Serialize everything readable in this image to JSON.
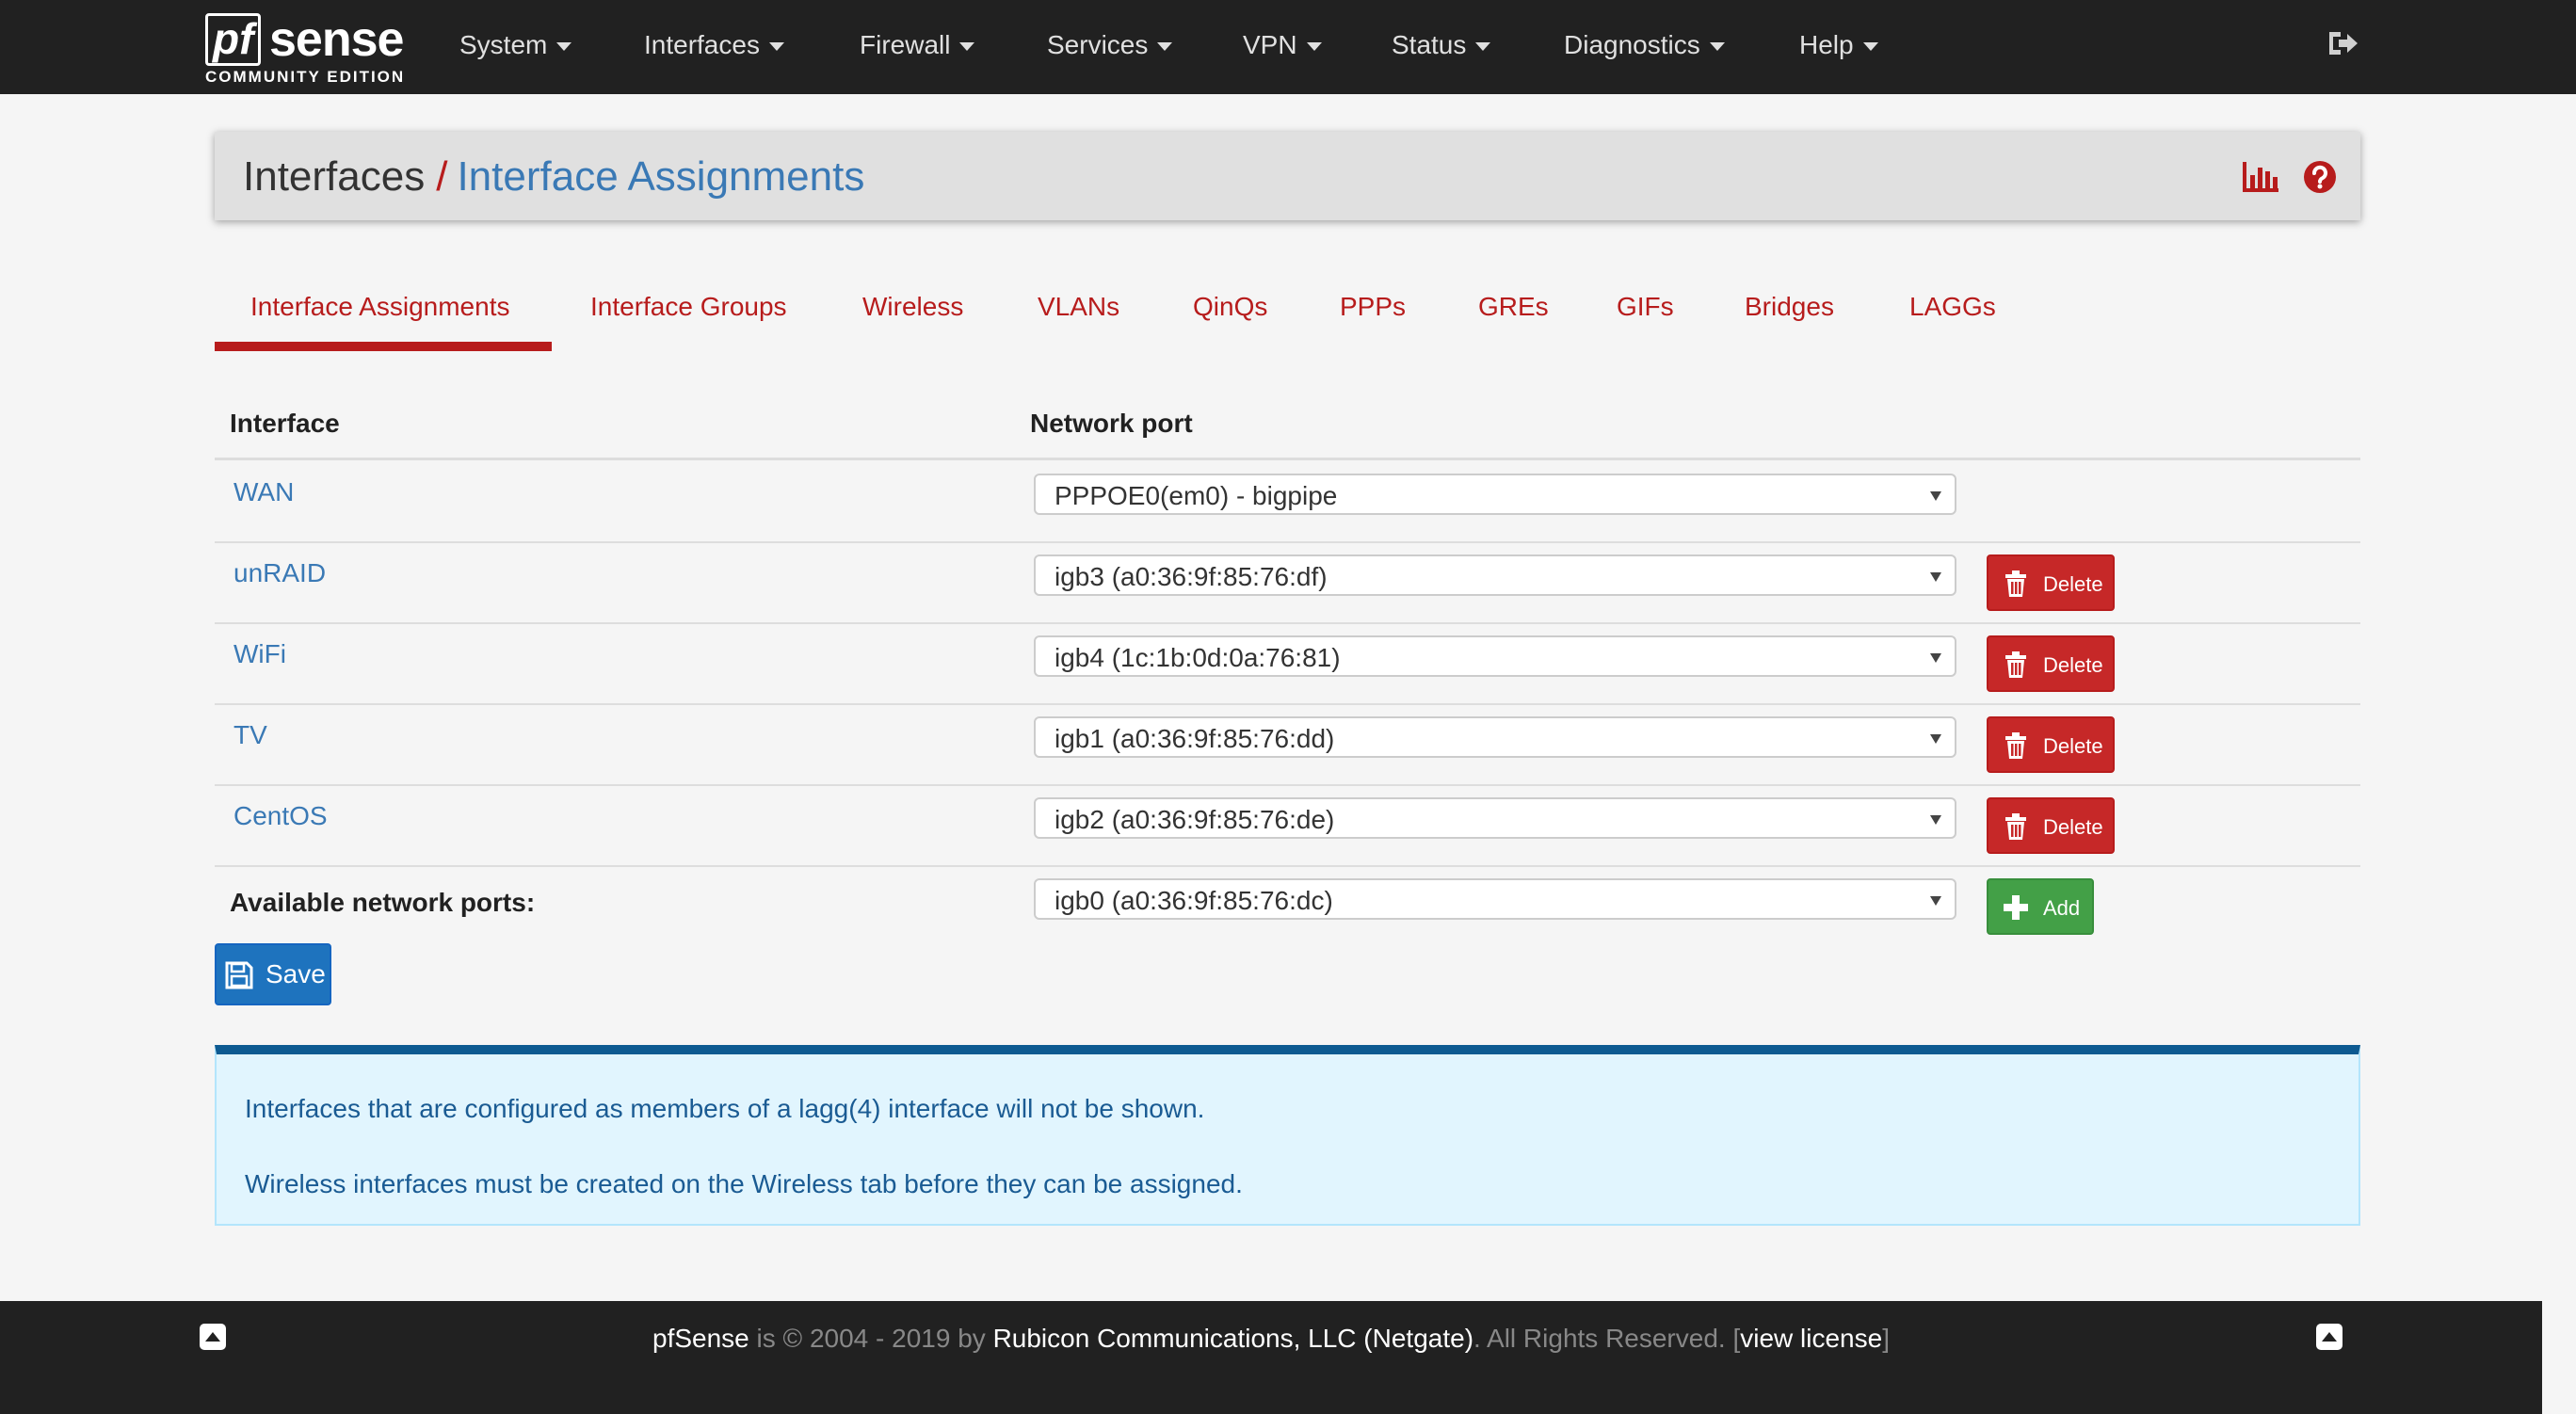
{
  "brand": {
    "logo_pf": "pf",
    "logo_sense": "sense",
    "edition": "COMMUNITY EDITION"
  },
  "nav": {
    "items": [
      "System",
      "Interfaces",
      "Firewall",
      "Services",
      "VPN",
      "Status",
      "Diagnostics",
      "Help"
    ],
    "logout_icon": "sign-out-icon"
  },
  "breadcrumb": {
    "parent": "Interfaces",
    "separator": "/",
    "current": "Interface Assignments"
  },
  "page_icons": {
    "chart": "bar-chart-icon",
    "help": "question-circle-icon"
  },
  "tabs": {
    "items": [
      "Interface Assignments",
      "Interface Groups",
      "Wireless",
      "VLANs",
      "QinQs",
      "PPPs",
      "GREs",
      "GIFs",
      "Bridges",
      "LAGGs"
    ],
    "active": "Interface Assignments"
  },
  "table": {
    "headers": [
      "Interface",
      "Network port"
    ],
    "rows": [
      {
        "interface": "WAN",
        "port": "PPPOE0(em0) - bigpipe",
        "action": ""
      },
      {
        "interface": "unRAID",
        "port": "igb3 (a0:36:9f:85:76:df)",
        "action": "Delete"
      },
      {
        "interface": "WiFi",
        "port": "igb4 (1c:1b:0d:0a:76:81)",
        "action": "Delete"
      },
      {
        "interface": "TV",
        "port": "igb1 (a0:36:9f:85:76:dd)",
        "action": "Delete"
      },
      {
        "interface": "CentOS",
        "port": "igb2 (a0:36:9f:85:76:de)",
        "action": "Delete"
      }
    ],
    "available_label": "Available network ports:",
    "available_port": "igb0 (a0:36:9f:85:76:dc)",
    "add_label": "Add"
  },
  "save_label": "Save",
  "info": {
    "line1": "Interfaces that are configured as members of a lagg(4) interface will not be shown.",
    "line2": "Wireless interfaces must be created on the Wireless tab before they can be assigned."
  },
  "footer": {
    "product": "pfSense",
    "is": "is",
    "copyright": "© 2004 - 2019 by",
    "company": "Rubicon Communications, LLC (Netgate)",
    "rights": ". All Rights Reserved. [",
    "license": "view license",
    "close_bracket": "]"
  },
  "colors": {
    "navbar": "#212121",
    "accent_red": "#b71c1c",
    "link_blue": "#3a79b5",
    "save_blue": "#1e73be",
    "add_green": "#43a047",
    "info_bg": "#e1f5fe"
  }
}
